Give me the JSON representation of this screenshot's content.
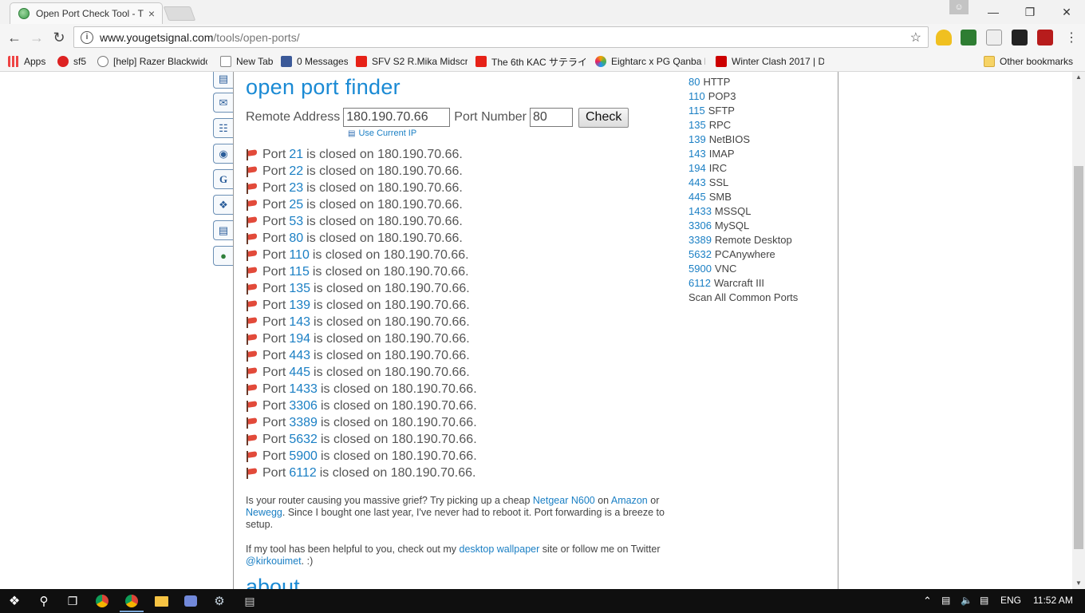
{
  "browser": {
    "tab_title": "Open Port Check Tool - T",
    "tab_close": "×",
    "url_host": "www.yougetsignal.com",
    "url_path": "/tools/open-ports/",
    "bookmarks": [
      {
        "label": "Apps",
        "color": "#e44"
      },
      {
        "label": "sf5",
        "color": "#d22"
      },
      {
        "label": "[help] Razer Blackwidc",
        "color": "#777"
      },
      {
        "label": "New Tab",
        "color": "#888"
      },
      {
        "label": "0 Messages",
        "color": "#3b5998"
      },
      {
        "label": "SFV S2 R.Mika Midscre",
        "color": "#e62117"
      },
      {
        "label": "The 6th KAC サテライト",
        "color": "#e62117"
      },
      {
        "label": "Eightarc x PG Qanba D",
        "color": "#f4a300"
      },
      {
        "label": "Winter Clash 2017 | D",
        "color": "#c00"
      }
    ],
    "other_bookmarks": "Other bookmarks"
  },
  "page": {
    "heading": "open port finder",
    "remote_label": "Remote Address",
    "remote_value": "180.190.70.66",
    "port_label": "Port Number",
    "port_value": "80",
    "check_button": "Check",
    "use_current_ip": "Use Current IP",
    "results": [
      {
        "pre": "Port",
        "port": "21",
        "post": "is closed on 180.190.70.66."
      },
      {
        "pre": "Port",
        "port": "22",
        "post": "is closed on 180.190.70.66."
      },
      {
        "pre": "Port",
        "port": "23",
        "post": "is closed on 180.190.70.66."
      },
      {
        "pre": "Port",
        "port": "25",
        "post": "is closed on 180.190.70.66."
      },
      {
        "pre": "Port",
        "port": "53",
        "post": "is closed on 180.190.70.66."
      },
      {
        "pre": "Port",
        "port": "80",
        "post": "is closed on 180.190.70.66."
      },
      {
        "pre": "Port",
        "port": "110",
        "post": "is closed on 180.190.70.66."
      },
      {
        "pre": "Port",
        "port": "115",
        "post": "is closed on 180.190.70.66."
      },
      {
        "pre": "Port",
        "port": "135",
        "post": "is closed on 180.190.70.66."
      },
      {
        "pre": "Port",
        "port": "139",
        "post": "is closed on 180.190.70.66."
      },
      {
        "pre": "Port",
        "port": "143",
        "post": "is closed on 180.190.70.66."
      },
      {
        "pre": "Port",
        "port": "194",
        "post": "is closed on 180.190.70.66."
      },
      {
        "pre": "Port",
        "port": "443",
        "post": "is closed on 180.190.70.66."
      },
      {
        "pre": "Port",
        "port": "445",
        "post": "is closed on 180.190.70.66."
      },
      {
        "pre": "Port",
        "port": "1433",
        "post": "is closed on 180.190.70.66."
      },
      {
        "pre": "Port",
        "port": "3306",
        "post": "is closed on 180.190.70.66."
      },
      {
        "pre": "Port",
        "port": "3389",
        "post": "is closed on 180.190.70.66."
      },
      {
        "pre": "Port",
        "port": "5632",
        "post": "is closed on 180.190.70.66."
      },
      {
        "pre": "Port",
        "port": "5900",
        "post": "is closed on 180.190.70.66."
      },
      {
        "pre": "Port",
        "port": "6112",
        "post": "is closed on 180.190.70.66."
      }
    ],
    "router_para": {
      "t1": "Is your router causing you massive grief? Try picking up a cheap ",
      "link1": "Netgear N600",
      "t2": " on ",
      "link2": "Amazon",
      "t3": " or ",
      "link3": "Newegg",
      "t4": ". Since I bought one last year, I've never had to reboot it. Port forwarding is a breeze to setup."
    },
    "helpful_para": {
      "t1": "If my tool has been helpful to you, check out my ",
      "link1": "desktop wallpaper",
      "t2": " site or follow me on Twitter ",
      "link2": "@kirkouimet",
      "t3": ". :)"
    },
    "about_heading": "about",
    "common_ports": [
      {
        "port": "80",
        "name": "HTTP"
      },
      {
        "port": "110",
        "name": "POP3"
      },
      {
        "port": "115",
        "name": "SFTP"
      },
      {
        "port": "135",
        "name": "RPC"
      },
      {
        "port": "139",
        "name": "NetBIOS"
      },
      {
        "port": "143",
        "name": "IMAP"
      },
      {
        "port": "194",
        "name": "IRC"
      },
      {
        "port": "443",
        "name": "SSL"
      },
      {
        "port": "445",
        "name": "SMB"
      },
      {
        "port": "1433",
        "name": "MSSQL"
      },
      {
        "port": "3306",
        "name": "MySQL"
      },
      {
        "port": "3389",
        "name": "Remote Desktop"
      },
      {
        "port": "5632",
        "name": "PCAnywhere"
      },
      {
        "port": "5900",
        "name": "VNC"
      },
      {
        "port": "6112",
        "name": "Warcraft III"
      }
    ],
    "scan_all": "Scan All Common Ports"
  },
  "taskbar": {
    "language": "ENG",
    "time": "11:52 AM"
  },
  "colors": {
    "link": "#1a7fc4",
    "heading": "#1a8ad4"
  }
}
